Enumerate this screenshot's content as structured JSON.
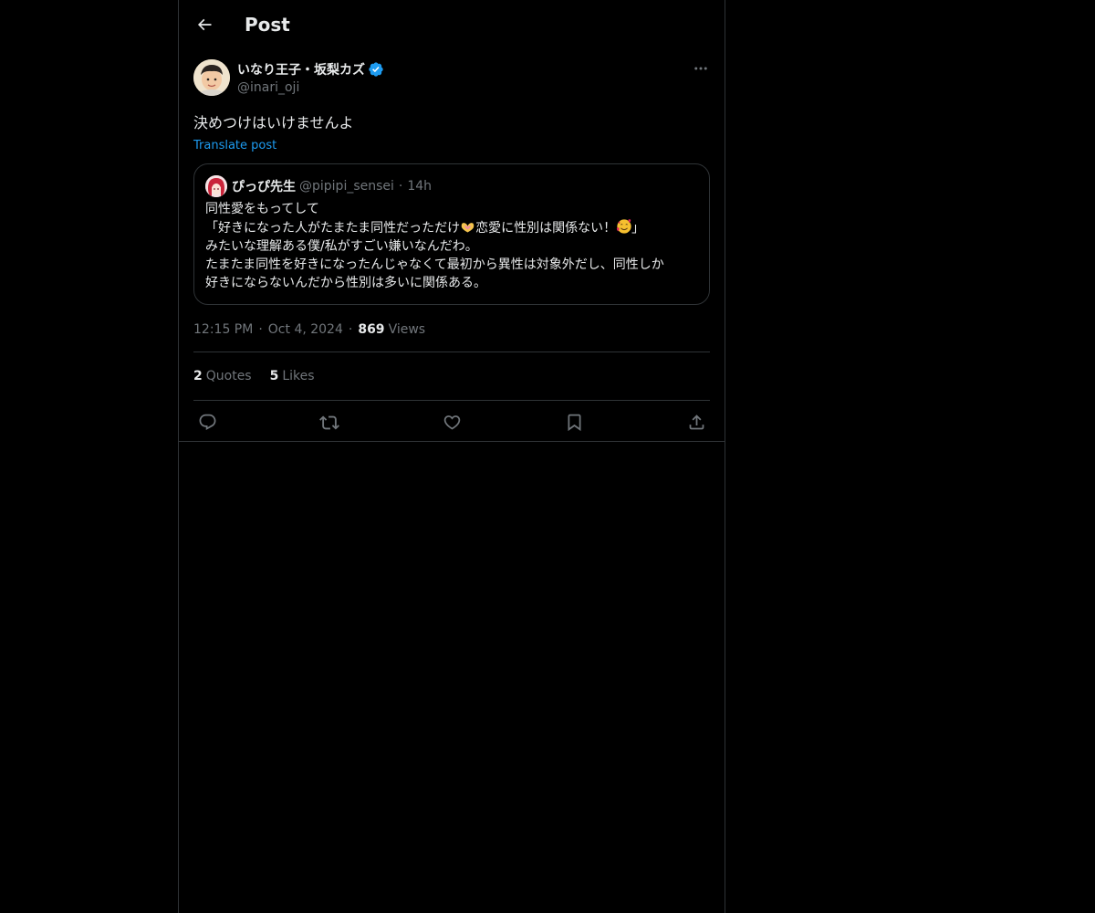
{
  "header": {
    "title": "Post",
    "back_icon": "arrow-left-icon"
  },
  "post": {
    "author": {
      "display_name": "いなり王子・坂梨カズ",
      "handle": "@inari_oji",
      "verified": true
    },
    "text": "決めつけはいけませんよ",
    "translate_label": "Translate post",
    "quote": {
      "display_name": "ぴっぴ先生",
      "handle": "@pipipi_sensei",
      "separator": "·",
      "time": "14h",
      "lines": [
        "同性愛をもってして",
        "「好きになった人がたまたま同性だっただけ",
        "恋愛に性別は関係ない！",
        "」",
        "みたいな理解ある僕/私がすごい嫌いなんだわ。",
        "たまたま同性を好きになったんじゃなくて最初から異性は対象外だし、同性しか",
        "好きにならないんだから性別は多いに関係ある。"
      ]
    },
    "meta": {
      "time": "12:15 PM",
      "sep": "·",
      "date": "Oct 4, 2024",
      "views_count": "869",
      "views_label": "Views"
    },
    "stats": {
      "quotes_count": "2",
      "quotes_label": "Quotes",
      "likes_count": "5",
      "likes_label": "Likes"
    },
    "actions": [
      "reply-icon",
      "repost-icon",
      "like-icon",
      "bookmark-icon",
      "share-icon"
    ]
  },
  "colors": {
    "background": "#000000",
    "text": "#e7e9ea",
    "secondary": "#71767b",
    "accent": "#1d9bf0",
    "border": "#2f3336"
  }
}
